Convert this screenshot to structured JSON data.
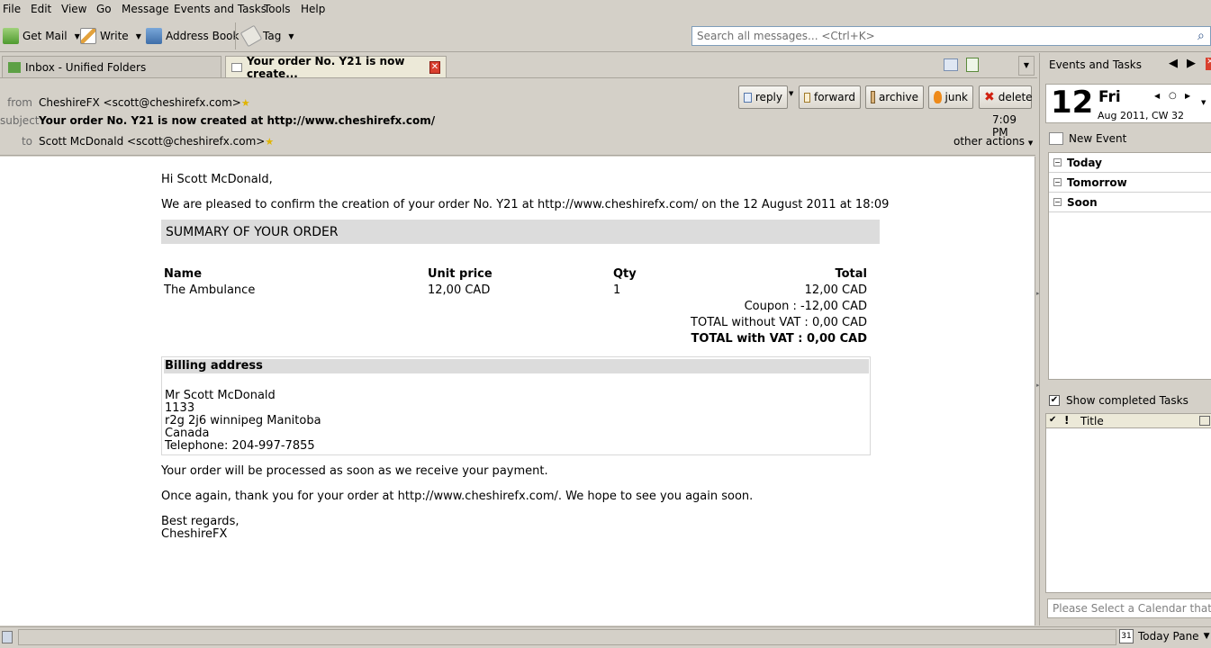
{
  "menubar": {
    "items": [
      "File",
      "Edit",
      "View",
      "Go",
      "Message",
      "Events and Tasks",
      "Tools",
      "Help"
    ]
  },
  "toolbar": {
    "get_mail": "Get Mail",
    "write": "Write",
    "address_book": "Address Book",
    "tag": "Tag",
    "search_placeholder": "Search all messages... <Ctrl+K>"
  },
  "tabs": [
    {
      "label": "Inbox - Unified Folders"
    },
    {
      "label": "Your order No. Y21 is now create..."
    }
  ],
  "header": {
    "from_label": "from",
    "from_value": "CheshireFX <scott@cheshirefx.com>",
    "subject_label": "subject",
    "subject_value": "Your order No. Y21 is now created at http://www.cheshirefx.com/",
    "to_label": "to",
    "to_value": "Scott McDonald <scott@cheshirefx.com>",
    "time": "7:09 PM",
    "other_actions": "other actions",
    "buttons": {
      "reply": "reply",
      "forward": "forward",
      "archive": "archive",
      "junk": "junk",
      "delete": "delete"
    }
  },
  "message": {
    "greeting": "Hi Scott McDonald,",
    "intro": "We are pleased to confirm the creation of your order No. Y21 at http://www.cheshirefx.com/ on the 12 August 2011 at 18:09",
    "summary_title": "SUMMARY OF YOUR ORDER",
    "table": {
      "headers": [
        "Name",
        "Unit price",
        "Qty",
        "Total"
      ],
      "row": [
        "The Ambulance",
        "12,00 CAD",
        "1",
        "12,00 CAD"
      ]
    },
    "coupon": "Coupon : -12,00 CAD",
    "total_without_vat": "TOTAL without VAT : 0,00 CAD",
    "total_with_vat": "TOTAL with VAT : 0,00 CAD",
    "billing_title": "Billing address",
    "billing_lines": [
      "Mr Scott McDonald",
      "1133",
      "r2g 2j6 winnipeg Manitoba",
      "Canada",
      "Telephone: 204-997-7855"
    ],
    "processing": "Your order will be processed as soon as we receive your payment.",
    "thanks": "Once again, thank you for your order at http://www.cheshirefx.com/. We hope to see you again soon.",
    "regards": "Best regards,",
    "signature": "CheshireFX"
  },
  "right_pane": {
    "title": "Events and Tasks",
    "day_number": "12",
    "day_name": "Fri",
    "date_line": "Aug 2011, CW 32",
    "new_event": "New Event",
    "agenda": [
      "Today",
      "Tomorrow",
      "Soon"
    ],
    "show_completed": "Show completed Tasks",
    "task_title_col": "Title",
    "task_input_placeholder": "Please Select a Calendar that Supports Tasks"
  },
  "status_bar": {
    "today_pane": "Today Pane",
    "today_pane_day": "31"
  },
  "colors": {
    "chrome": "#d4d0c8",
    "summary_bar": "#dcdcdc",
    "close_red": "#d9402e"
  }
}
